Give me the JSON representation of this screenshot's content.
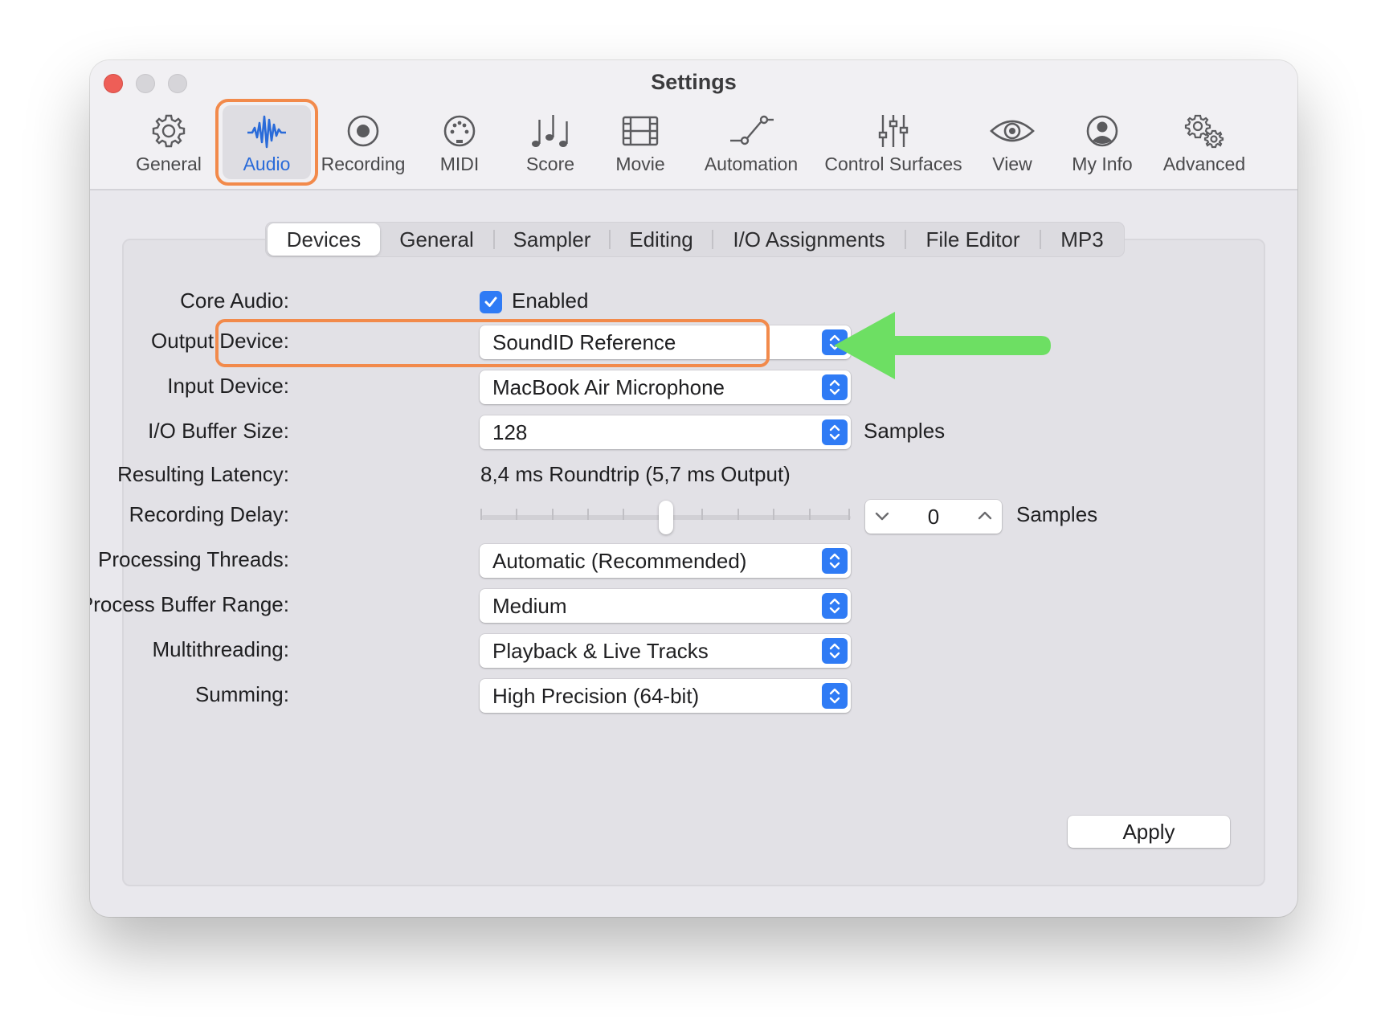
{
  "window": {
    "title": "Settings"
  },
  "toolbar": {
    "items": [
      {
        "label": "General",
        "icon": "gear-icon"
      },
      {
        "label": "Audio",
        "icon": "waveform-icon",
        "active": true
      },
      {
        "label": "Recording",
        "icon": "record-icon"
      },
      {
        "label": "MIDI",
        "icon": "midi-port-icon"
      },
      {
        "label": "Score",
        "icon": "music-notes-icon"
      },
      {
        "label": "Movie",
        "icon": "film-icon"
      },
      {
        "label": "Automation",
        "icon": "automation-curve-icon"
      },
      {
        "label": "Control Surfaces",
        "icon": "faders-icon"
      },
      {
        "label": "View",
        "icon": "eye-icon"
      },
      {
        "label": "My Info",
        "icon": "person-icon"
      },
      {
        "label": "Advanced",
        "icon": "gears-icon"
      }
    ]
  },
  "tabs": [
    {
      "label": "Devices",
      "active": true
    },
    {
      "label": "General"
    },
    {
      "label": "Sampler"
    },
    {
      "label": "Editing"
    },
    {
      "label": "I/O Assignments"
    },
    {
      "label": "File Editor"
    },
    {
      "label": "MP3"
    }
  ],
  "form": {
    "core_audio": {
      "label": "Core Audio:",
      "checkbox_label": "Enabled",
      "checked": true
    },
    "output_device": {
      "label": "Output Device:",
      "value": "SoundID Reference"
    },
    "input_device": {
      "label": "Input Device:",
      "value": "MacBook Air Microphone"
    },
    "io_buffer_size": {
      "label": "I/O Buffer Size:",
      "value": "128",
      "unit": "Samples"
    },
    "resulting_latency": {
      "label": "Resulting Latency:",
      "value": "8,4 ms Roundtrip (5,7 ms Output)"
    },
    "recording_delay": {
      "label": "Recording Delay:",
      "value": "0",
      "unit": "Samples"
    },
    "processing_threads": {
      "label": "Processing Threads:",
      "value": "Automatic (Recommended)"
    },
    "process_buffer_range": {
      "label": "Process Buffer Range:",
      "value": "Medium"
    },
    "multithreading": {
      "label": "Multithreading:",
      "value": "Playback & Live Tracks"
    },
    "summing": {
      "label": "Summing:",
      "value": "High Precision (64-bit)"
    }
  },
  "apply_label": "Apply",
  "colors": {
    "accent": "#2f7bf5",
    "highlight_outline": "#f28a4b",
    "annotation_arrow": "#6ddf63"
  }
}
